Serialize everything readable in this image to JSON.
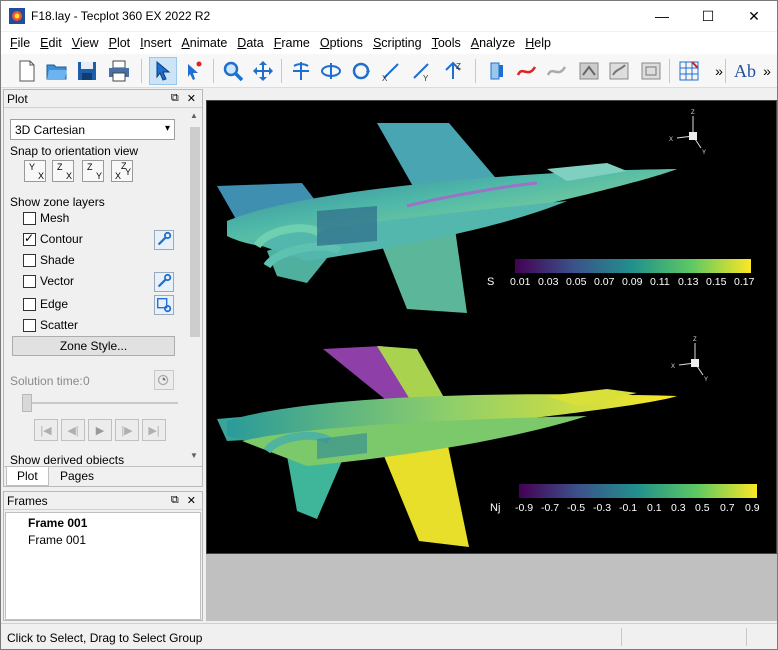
{
  "window": {
    "title": "F18.lay - Tecplot 360 EX 2022 R2",
    "minimize": "—",
    "maximize": "☐",
    "close": "✕"
  },
  "menu": [
    "File",
    "Edit",
    "View",
    "Plot",
    "Insert",
    "Animate",
    "Data",
    "Frame",
    "Options",
    "Scripting",
    "Tools",
    "Analyze",
    "Help"
  ],
  "toolbar": {
    "overflow_1": "»",
    "text_tool": "Ab",
    "overflow_2": "»"
  },
  "plot_panel": {
    "title": "Plot",
    "plot_type": "3D Cartesian",
    "snap_label": "Snap to orientation view",
    "orientations": [
      {
        "top": "Y",
        "bottom": "X"
      },
      {
        "top": "Z",
        "bottom": "X"
      },
      {
        "top": "Z",
        "bottom": "Y"
      },
      {
        "top": "Z",
        "mid": "Y",
        "bottom": "X"
      }
    ],
    "zone_layers_label": "Show zone layers",
    "layers": [
      {
        "label": "Mesh",
        "checked": false
      },
      {
        "label": "Contour",
        "checked": true
      },
      {
        "label": "Shade",
        "checked": false
      },
      {
        "label": "Vector",
        "checked": false
      },
      {
        "label": "Edge",
        "checked": false
      },
      {
        "label": "Scatter",
        "checked": false
      }
    ],
    "zone_style_button": "Zone Style...",
    "solution_time_label": "Solution time:",
    "solution_time_value": "0",
    "derived_label": "Show derived objects",
    "tabs": [
      "Plot",
      "Pages"
    ],
    "active_tab": "Plot"
  },
  "frames_panel": {
    "title": "Frames",
    "items": [
      {
        "label": "Frame 001",
        "bold": true
      },
      {
        "label": "Frame 001",
        "bold": false
      }
    ]
  },
  "legends": [
    {
      "variable": "S",
      "ticks": [
        "0.01",
        "0.03",
        "0.05",
        "0.07",
        "0.09",
        "0.11",
        "0.13",
        "0.15",
        "0.17"
      ]
    },
    {
      "variable": "Nj",
      "ticks": [
        "-0.9",
        "-0.7",
        "-0.5",
        "-0.3",
        "-0.1",
        "0.1",
        "0.3",
        "0.5",
        "0.7",
        "0.9"
      ]
    }
  ],
  "axis_triad": {
    "x": "X",
    "y": "Y",
    "z": "Z"
  },
  "colors": {
    "viridis_start": "#440154",
    "viridis_mid": "#21918c",
    "viridis_end": "#fde725",
    "frame_background": "#000000",
    "workspace_background": "#c0c0c0"
  },
  "status_bar": {
    "text": "Click to Select, Drag to Select Group"
  }
}
